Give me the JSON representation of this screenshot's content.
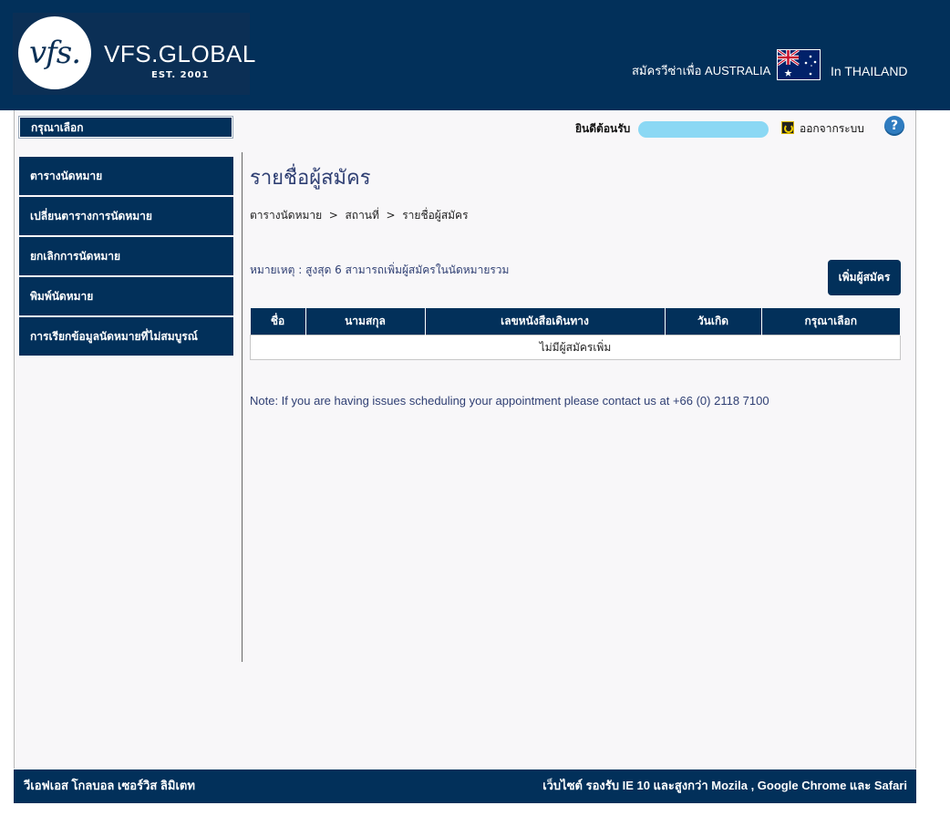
{
  "header": {
    "logo_mark": "vfs.",
    "logo_name": "VFS.GLOBAL",
    "logo_est": "EST. 2001",
    "apply_text": "สมัครวีซ่าเพื่อ AUSTRALIA",
    "country_text": "In THAILAND",
    "flag_icon": "australia-flag-icon"
  },
  "topbar": {
    "select_label": "กรุณาเลือก",
    "welcome_text": "ยินดีต้อนรับ",
    "logout_label": "ออกจากระบบ",
    "help_label": "?"
  },
  "sidebar": {
    "items": [
      {
        "label": "ตารางนัดหมาย"
      },
      {
        "label": "เปลี่ยนตารางการนัดหมาย"
      },
      {
        "label": "ยกเลิกการนัดหมาย"
      },
      {
        "label": "พิมพ์นัดหมาย"
      },
      {
        "label": "การเรียกข้อมูลนัดหมายที่ไม่สมบูรณ์"
      }
    ]
  },
  "main": {
    "title": "รายชื่อผู้สมัคร",
    "breadcrumb": "ตารางนัดหมาย  >  สถานที่  >  รายชื่อผู้สมัคร",
    "note": "หมายเหตุ : สูงสุด 6 สามารถเพิ่มผู้สมัครในนัดหมายรวม",
    "add_button": "เพิ่มผู้สมัคร",
    "table": {
      "headers": [
        "ชื่อ",
        "นามสกุล",
        "เลขหนังสือเดินทาง",
        "วันเกิด",
        "กรุณาเลือก"
      ],
      "empty_message": "ไม่มีผู้สมัครเพิ่ม"
    },
    "contact_note": "Note: If you are having issues scheduling your appointment please contact us at +66 (0) 2118 7100"
  },
  "footer": {
    "left": "วีเอฟเอส โกลบอล เซอร์วิส ลิมิเตท",
    "right": "เว็บไซต์ รองรับ IE 10 และสูงกว่า Mozila , Google Chrome และ Safari"
  },
  "colors": {
    "brand_navy": "#02305a",
    "title_text": "#2f3f73",
    "panel_bg": "#f8f7f9"
  }
}
